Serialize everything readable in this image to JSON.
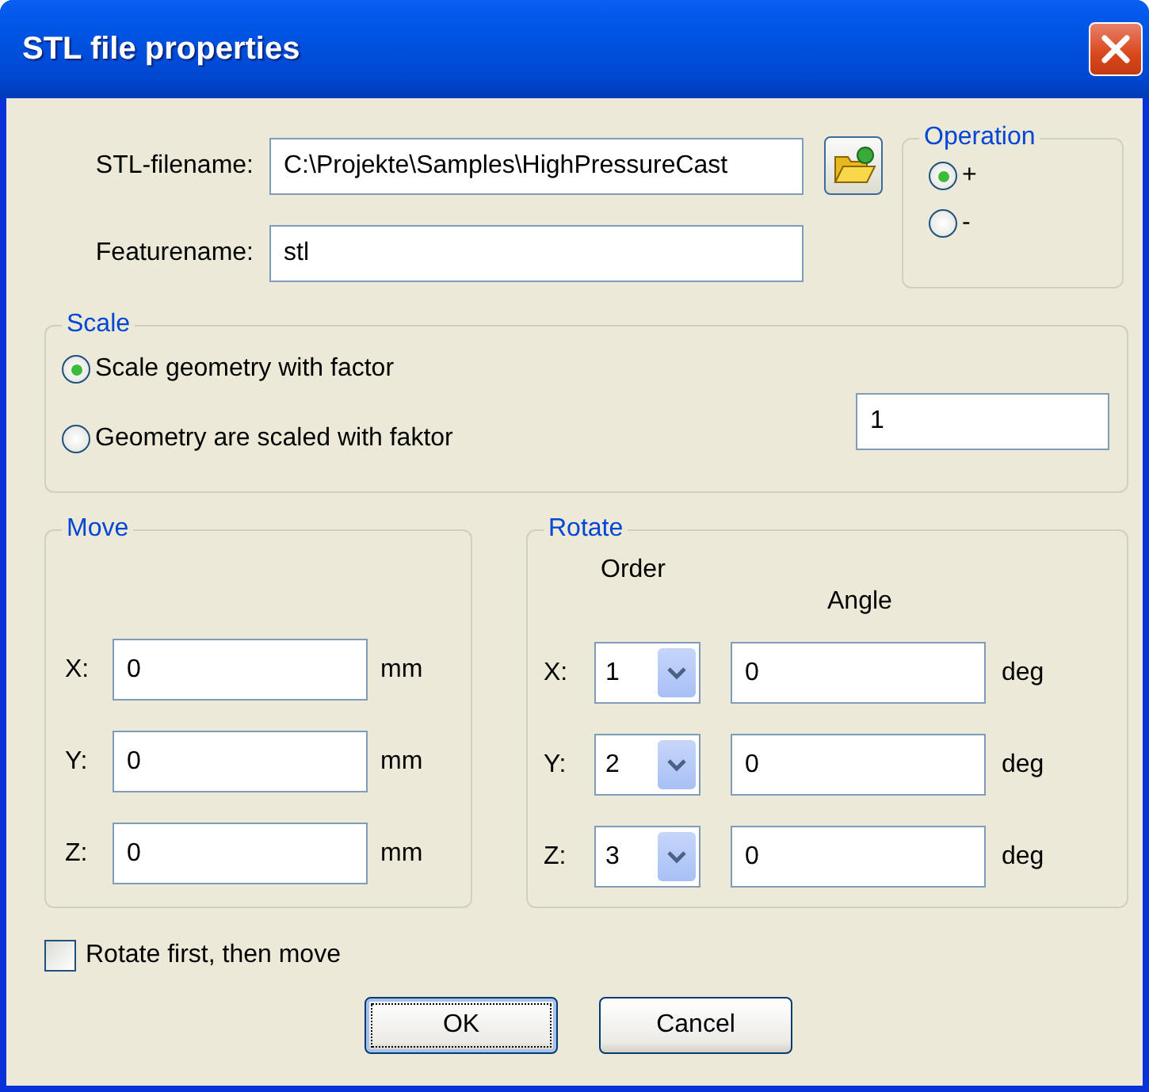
{
  "window": {
    "title": "STL file properties"
  },
  "file": {
    "filename_label": "STL-filename:",
    "filename": "C:\\Projekte\\Samples\\HighPressureCast",
    "featurename_label": "Featurename:",
    "featurename": "stl"
  },
  "operation": {
    "title": "Operation",
    "options": [
      {
        "label": "+",
        "selected": true
      },
      {
        "label": "-",
        "selected": false
      }
    ]
  },
  "scale": {
    "title": "Scale",
    "options": [
      {
        "label": "Scale geometry with factor",
        "selected": true
      },
      {
        "label": "Geometry are scaled with faktor",
        "selected": false
      }
    ],
    "factor": "1"
  },
  "move": {
    "title": "Move",
    "rows": [
      {
        "axis": "X:",
        "value": "0",
        "unit": "mm"
      },
      {
        "axis": "Y:",
        "value": "0",
        "unit": "mm"
      },
      {
        "axis": "Z:",
        "value": "0",
        "unit": "mm"
      }
    ]
  },
  "rotate": {
    "title": "Rotate",
    "order_label": "Order",
    "angle_label": "Angle",
    "rows": [
      {
        "axis": "X:",
        "order": "1",
        "angle": "0",
        "unit": "deg"
      },
      {
        "axis": "Y:",
        "order": "2",
        "angle": "0",
        "unit": "deg"
      },
      {
        "axis": "Z:",
        "order": "3",
        "angle": "0",
        "unit": "deg"
      }
    ]
  },
  "rotate_first": {
    "label": "Rotate first, then move",
    "checked": false
  },
  "buttons": [
    {
      "label": "OK",
      "default": true
    },
    {
      "label": "Cancel",
      "default": false
    }
  ]
}
